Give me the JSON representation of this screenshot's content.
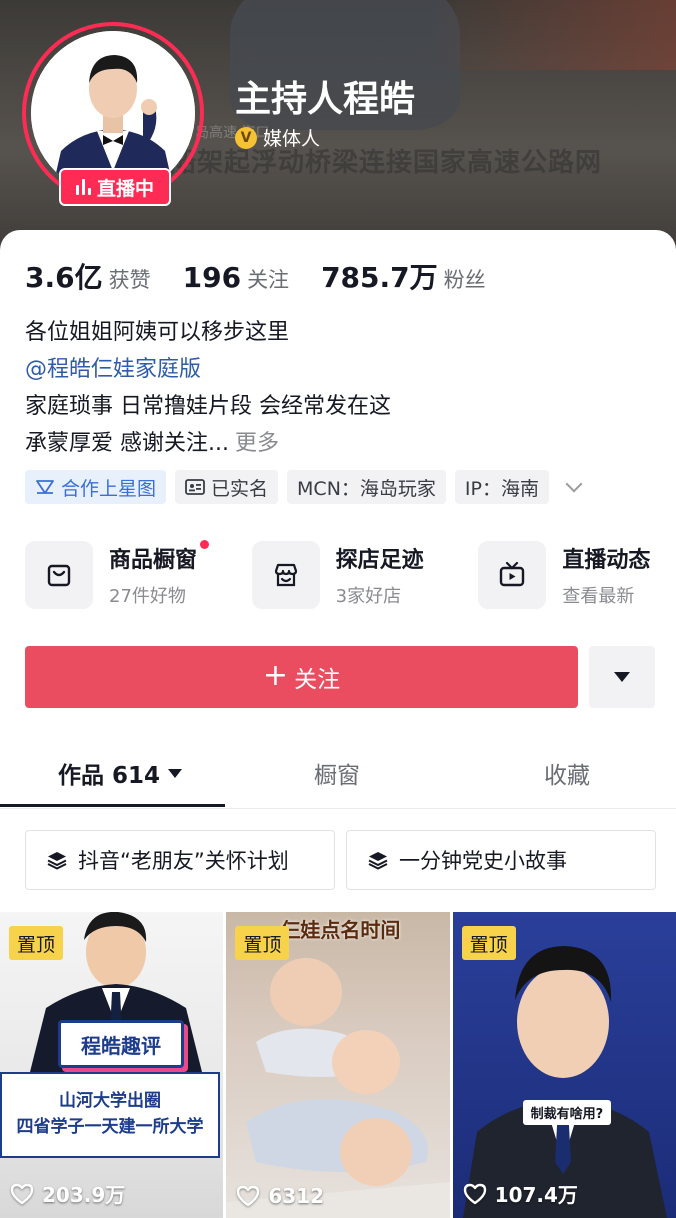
{
  "header": {
    "name": "主持人程皓",
    "verify_icon": "V",
    "verify_label": "媒体人",
    "live_label": "直播中",
    "background_caption": "船架起浮动桥梁连接国家高速公路网",
    "background_small_caption": "岛高速·海口"
  },
  "stats": [
    {
      "value": "3.6亿",
      "label": "获赞"
    },
    {
      "value": "196",
      "label": "关注"
    },
    {
      "value": "785.7万",
      "label": "粉丝"
    }
  ],
  "bio": {
    "line1": "各位姐姐阿姨可以移步这里",
    "link": "@程皓仨娃家庭版",
    "line3": "家庭琐事 日常撸娃片段 会经常发在这",
    "line4": "承蒙厚爱 感谢关注...",
    "more": "更多"
  },
  "tags": {
    "star": "合作上星图",
    "realname": "已实名",
    "mcn": "MCN：海岛玩家",
    "ip": "IP：海南"
  },
  "features": [
    {
      "title": "商品橱窗",
      "subtitle": "27件好物",
      "icon": "bag-icon",
      "dot": true
    },
    {
      "title": "探店足迹",
      "subtitle": "3家好店",
      "icon": "store-icon",
      "dot": false
    },
    {
      "title": "直播动态",
      "subtitle": "查看最新",
      "icon": "tv-icon",
      "dot": false
    }
  ],
  "follow": {
    "plus": "+",
    "label": "关注"
  },
  "tabs": [
    {
      "label": "作品 614"
    },
    {
      "label": "橱窗"
    },
    {
      "label": "收藏"
    }
  ],
  "collections": [
    {
      "label": "抖音“老朋友”关怀计划"
    },
    {
      "label": "一分钟党史小故事"
    }
  ],
  "videos": [
    {
      "pin": "置顶",
      "likes": "203.9万",
      "tag": "程皓趣评",
      "caption1": "山河大学出圈",
      "caption2": "四省学子一天建一所大学"
    },
    {
      "pin": "置顶",
      "likes": "6312",
      "caption": "仨娃点名时间"
    },
    {
      "pin": "置顶",
      "likes": "107.4万",
      "caption": "制裁有啥用?"
    }
  ],
  "colors": {
    "accent": "#fe2c55",
    "follow_button": "#ea4d5f",
    "pin_badge": "#f7d24b",
    "link": "#2f5ca8"
  }
}
